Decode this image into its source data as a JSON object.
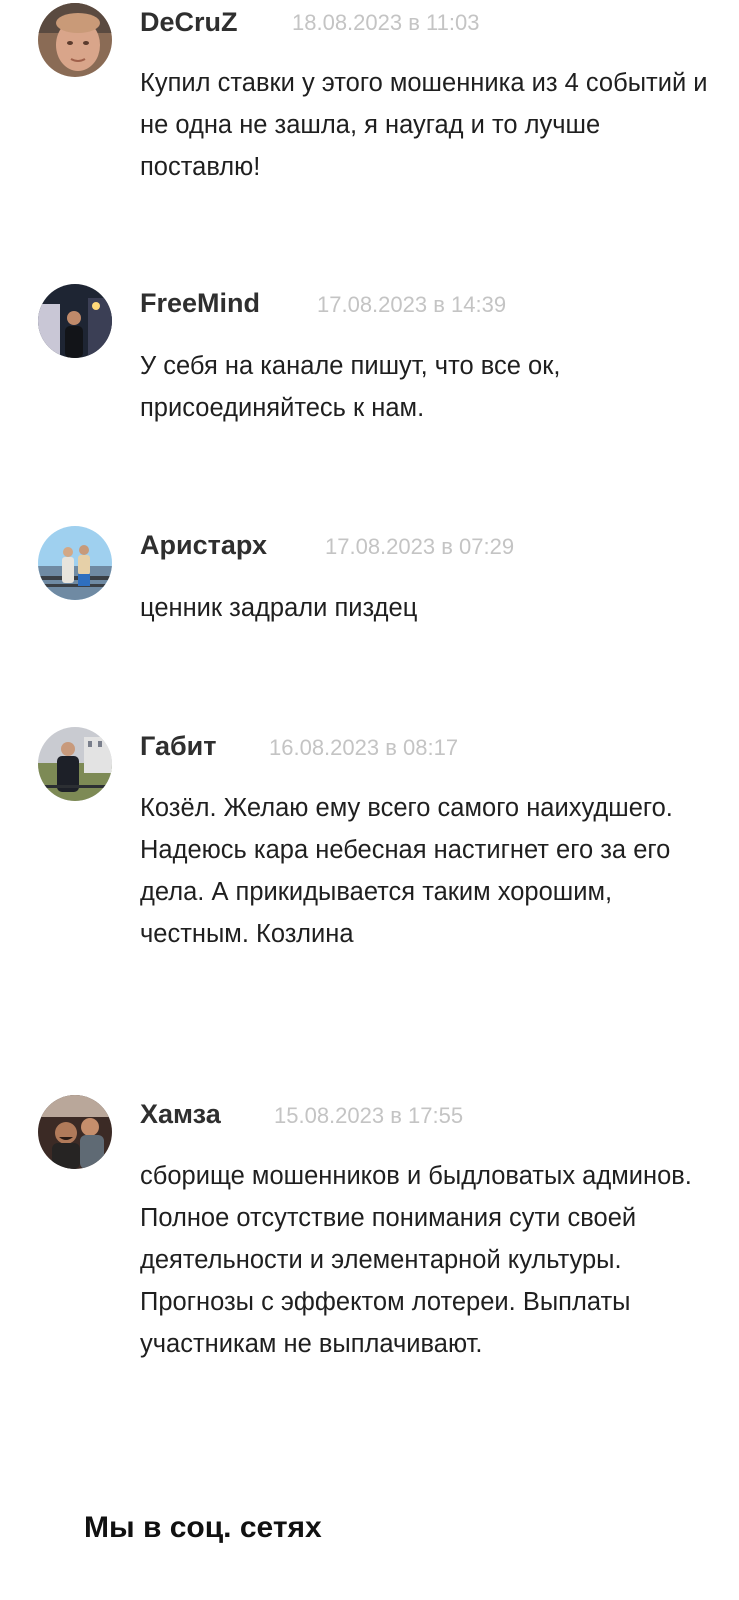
{
  "comments": [
    {
      "author": "DeCruZ",
      "date": "18.08.2023 в 11:03",
      "text": "Купил ставки у этого мошенника из 4 событий и не одна не зашла, я наугад и то лучше поставлю!"
    },
    {
      "author": "FreeMind",
      "date": "17.08.2023 в 14:39",
      "text": "У себя на канале пишут, что все ок, присоединяйтесь к нам."
    },
    {
      "author": "Аристарх",
      "date": "17.08.2023 в 07:29",
      "text": "ценник задрали пиздец"
    },
    {
      "author": "Габит",
      "date": "16.08.2023 в 08:17",
      "text": "Козёл. Желаю ему всего самого наихудшего. Надеюсь кара небесная настигнет его за его дела. А прикидывается таким хорошим, честным. Козлина"
    },
    {
      "author": "Хамза",
      "date": "15.08.2023 в 17:55",
      "text": "сборище мошенников и быдловатых админов. Полное отсутствие понимания сути своей деятельности и элементарной культуры. Прогнозы с эффектом лотереи. Выплаты участникам не выплачивают."
    }
  ],
  "social": {
    "title": "Мы в соц. сетях"
  }
}
